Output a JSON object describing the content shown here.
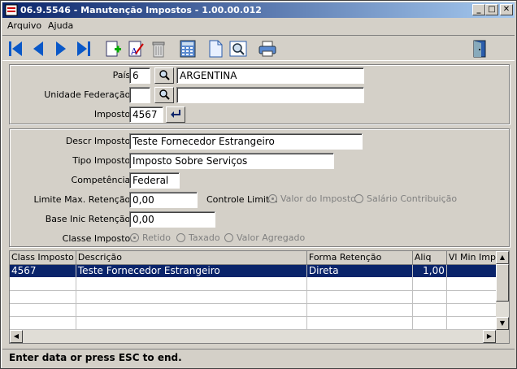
{
  "window": {
    "title": "06.9.5546 - Manutenção Impostos - 1.00.00.012",
    "minimize": "_",
    "maximize": "□",
    "close": "✕"
  },
  "menu": {
    "items": [
      {
        "label": "Arquivo",
        "hotkey": "A"
      },
      {
        "label": "Ajuda",
        "hotkey": "j"
      }
    ]
  },
  "toolbar": {
    "buttons": [
      "first-icon",
      "prev-icon",
      "next-icon",
      "last-icon",
      "add-icon",
      "edit-icon",
      "delete-icon",
      "calculator-icon",
      "new-document-icon",
      "zoom-icon",
      "print-icon",
      "exit-icon"
    ]
  },
  "header_panel": {
    "pais_label": "País:",
    "pais_code": "6",
    "pais_name": "ARGENTINA",
    "uf_label": "Unidade Federação:",
    "uf_code": "",
    "uf_name": "",
    "imposto_label": "Imposto:",
    "imposto_value": "4567"
  },
  "details": {
    "descr_label": "Descr  Imposto:",
    "descr_value": "Teste Fornecedor Estrangeiro",
    "tipo_label": "Tipo Imposto:",
    "tipo_value": "Imposto Sobre Serviços",
    "competencia_label": "Competência:",
    "competencia_value": "Federal",
    "limite_label": "Limite Max. Retenção:",
    "limite_value": "0,00",
    "controle_label": "Controle Limite:",
    "controle_options": [
      "Valor do Imposto",
      "Salário Contribuição"
    ],
    "base_label": "Base Inic Retenção:",
    "base_value": "0,00",
    "classe_label": "Classe Imposto:",
    "classe_options": [
      "Retido",
      "Taxado",
      "Valor Agregado"
    ]
  },
  "grid": {
    "columns": [
      "Class Imposto",
      "Descrição",
      "Forma Retenção",
      "Aliq",
      "Vl Min Imp"
    ],
    "rows": [
      [
        "4567",
        "Teste Fornecedor Estrangeiro",
        "Direta",
        "1,00",
        ""
      ]
    ]
  },
  "status": {
    "text": "Enter data or press ESC to end."
  }
}
